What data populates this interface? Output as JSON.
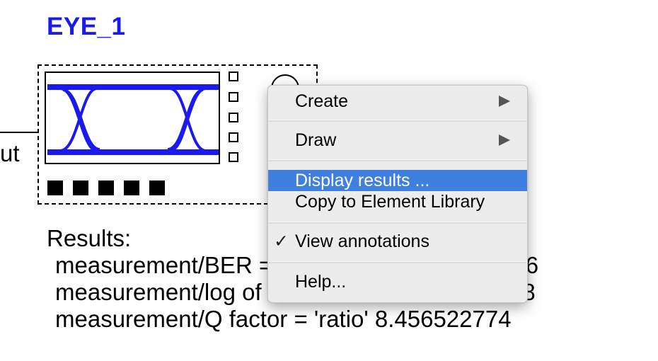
{
  "block": {
    "title": "EYE_1",
    "port_label": "ut"
  },
  "results": {
    "heading": "Results:",
    "lines": [
      "measurement/BER = 'BER' 0.407267749e-006",
      "measurement/log of BER = 'BER' -6.39011998",
      "measurement/Q factor = 'ratio' 8.456522774"
    ]
  },
  "context_menu": {
    "items": [
      {
        "label": "Create",
        "submenu": true
      },
      {
        "label": "Draw",
        "submenu": true
      },
      {
        "label": "Display results ...",
        "selected": true
      },
      {
        "label": "Copy to Element Library"
      },
      {
        "label": "View annotations",
        "checked": true,
        "check_glyph": "✓"
      },
      {
        "label": "Help..."
      }
    ]
  },
  "colors": {
    "title": "#1a1aee",
    "eye_trace": "#1a1aee",
    "menu_selection": "#3f7fe0",
    "menu_background": "#ececec"
  }
}
